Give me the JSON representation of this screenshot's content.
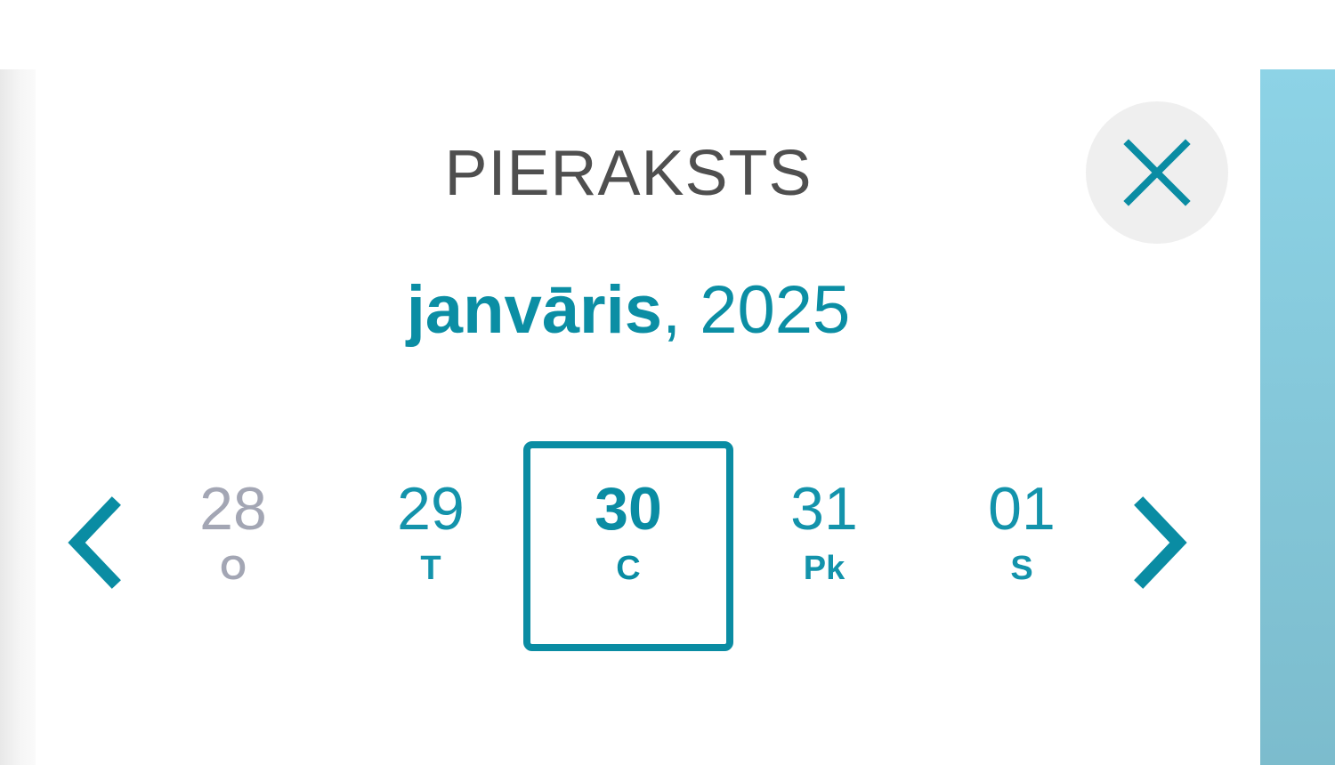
{
  "modal": {
    "title": "PIERAKSTS",
    "close_icon": "close-icon",
    "month_name": "janvāris",
    "year_suffix": ", 2025"
  },
  "calendar": {
    "prev_icon": "chevron-left-icon",
    "next_icon": "chevron-right-icon",
    "days": [
      {
        "num": "28",
        "weekday": "O",
        "state": "past"
      },
      {
        "num": "29",
        "weekday": "T",
        "state": "future"
      },
      {
        "num": "30",
        "weekday": "C",
        "state": "selected"
      },
      {
        "num": "31",
        "weekday": "Pk",
        "state": "future"
      },
      {
        "num": "01",
        "weekday": "S",
        "state": "future"
      }
    ]
  },
  "colors": {
    "accent": "#0a8ca3",
    "muted": "#a3a6b4",
    "title": "#4f4f4f",
    "close_bg": "#efefef",
    "side_panel": "#8dd3e6"
  }
}
